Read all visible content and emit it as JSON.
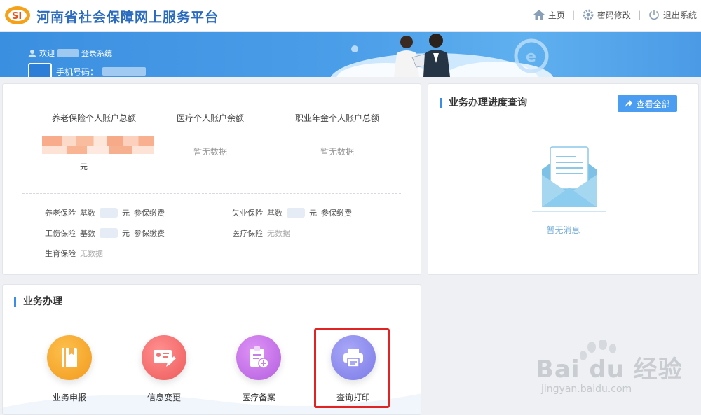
{
  "header": {
    "logo_text": "SI",
    "site_title": "河南省社会保障网上服务平台",
    "nav": [
      {
        "label": "主页",
        "icon": "home-icon"
      },
      {
        "label": "密码修改",
        "icon": "gear-icon"
      },
      {
        "label": "退出系统",
        "icon": "power-icon"
      }
    ],
    "separator": "|"
  },
  "banner": {
    "welcome_prefix": "欢迎",
    "welcome_suffix": "登录系统",
    "phone_label": "手机号码："
  },
  "account": {
    "columns": [
      {
        "label": "养老保险个人账户总额",
        "value": ""
      },
      {
        "label": "医疗个人账户余额",
        "value": "暂无数据"
      },
      {
        "label": "职业年金个人账户总额",
        "value": "暂无数据"
      }
    ],
    "yuan": "元",
    "insurance": [
      {
        "name": "养老保险",
        "base_label": "基数",
        "unit": "元",
        "status": "参保缴费",
        "muted": ""
      },
      {
        "name": "失业保险",
        "base_label": "基数",
        "unit": "元",
        "status": "参保缴费",
        "muted": ""
      },
      {
        "name": "工伤保险",
        "base_label": "基数",
        "unit": "元",
        "status": "参保缴费",
        "muted": ""
      },
      {
        "name": "医疗保险",
        "base_label": "",
        "unit": "",
        "status": "",
        "muted": "无数据"
      },
      {
        "name": "生育保险",
        "base_label": "",
        "unit": "",
        "status": "",
        "muted": "无数据"
      }
    ]
  },
  "progress": {
    "title": "业务办理进度查询",
    "view_all": "查看全部",
    "empty": "暂无消息"
  },
  "business": {
    "title": "业务办理",
    "items": [
      {
        "label": "业务申报",
        "icon": "book-icon",
        "color": "#f7a233"
      },
      {
        "label": "信息变更",
        "icon": "id-card-edit-icon",
        "color": "#f26a6a"
      },
      {
        "label": "医疗备案",
        "icon": "clipboard-plus-icon",
        "color": "#c86ae8"
      },
      {
        "label": "查询打印",
        "icon": "printer-icon",
        "color": "#8d8cf0"
      }
    ]
  },
  "watermark": {
    "text": "Bai du 经验",
    "sub": "jingyan.baidu.com"
  },
  "colors": {
    "brand_blue": "#2a6bbf",
    "banner_blue": "#4b9ee8",
    "accent_button": "#4a9df0",
    "highlight_red": "#e02424"
  }
}
